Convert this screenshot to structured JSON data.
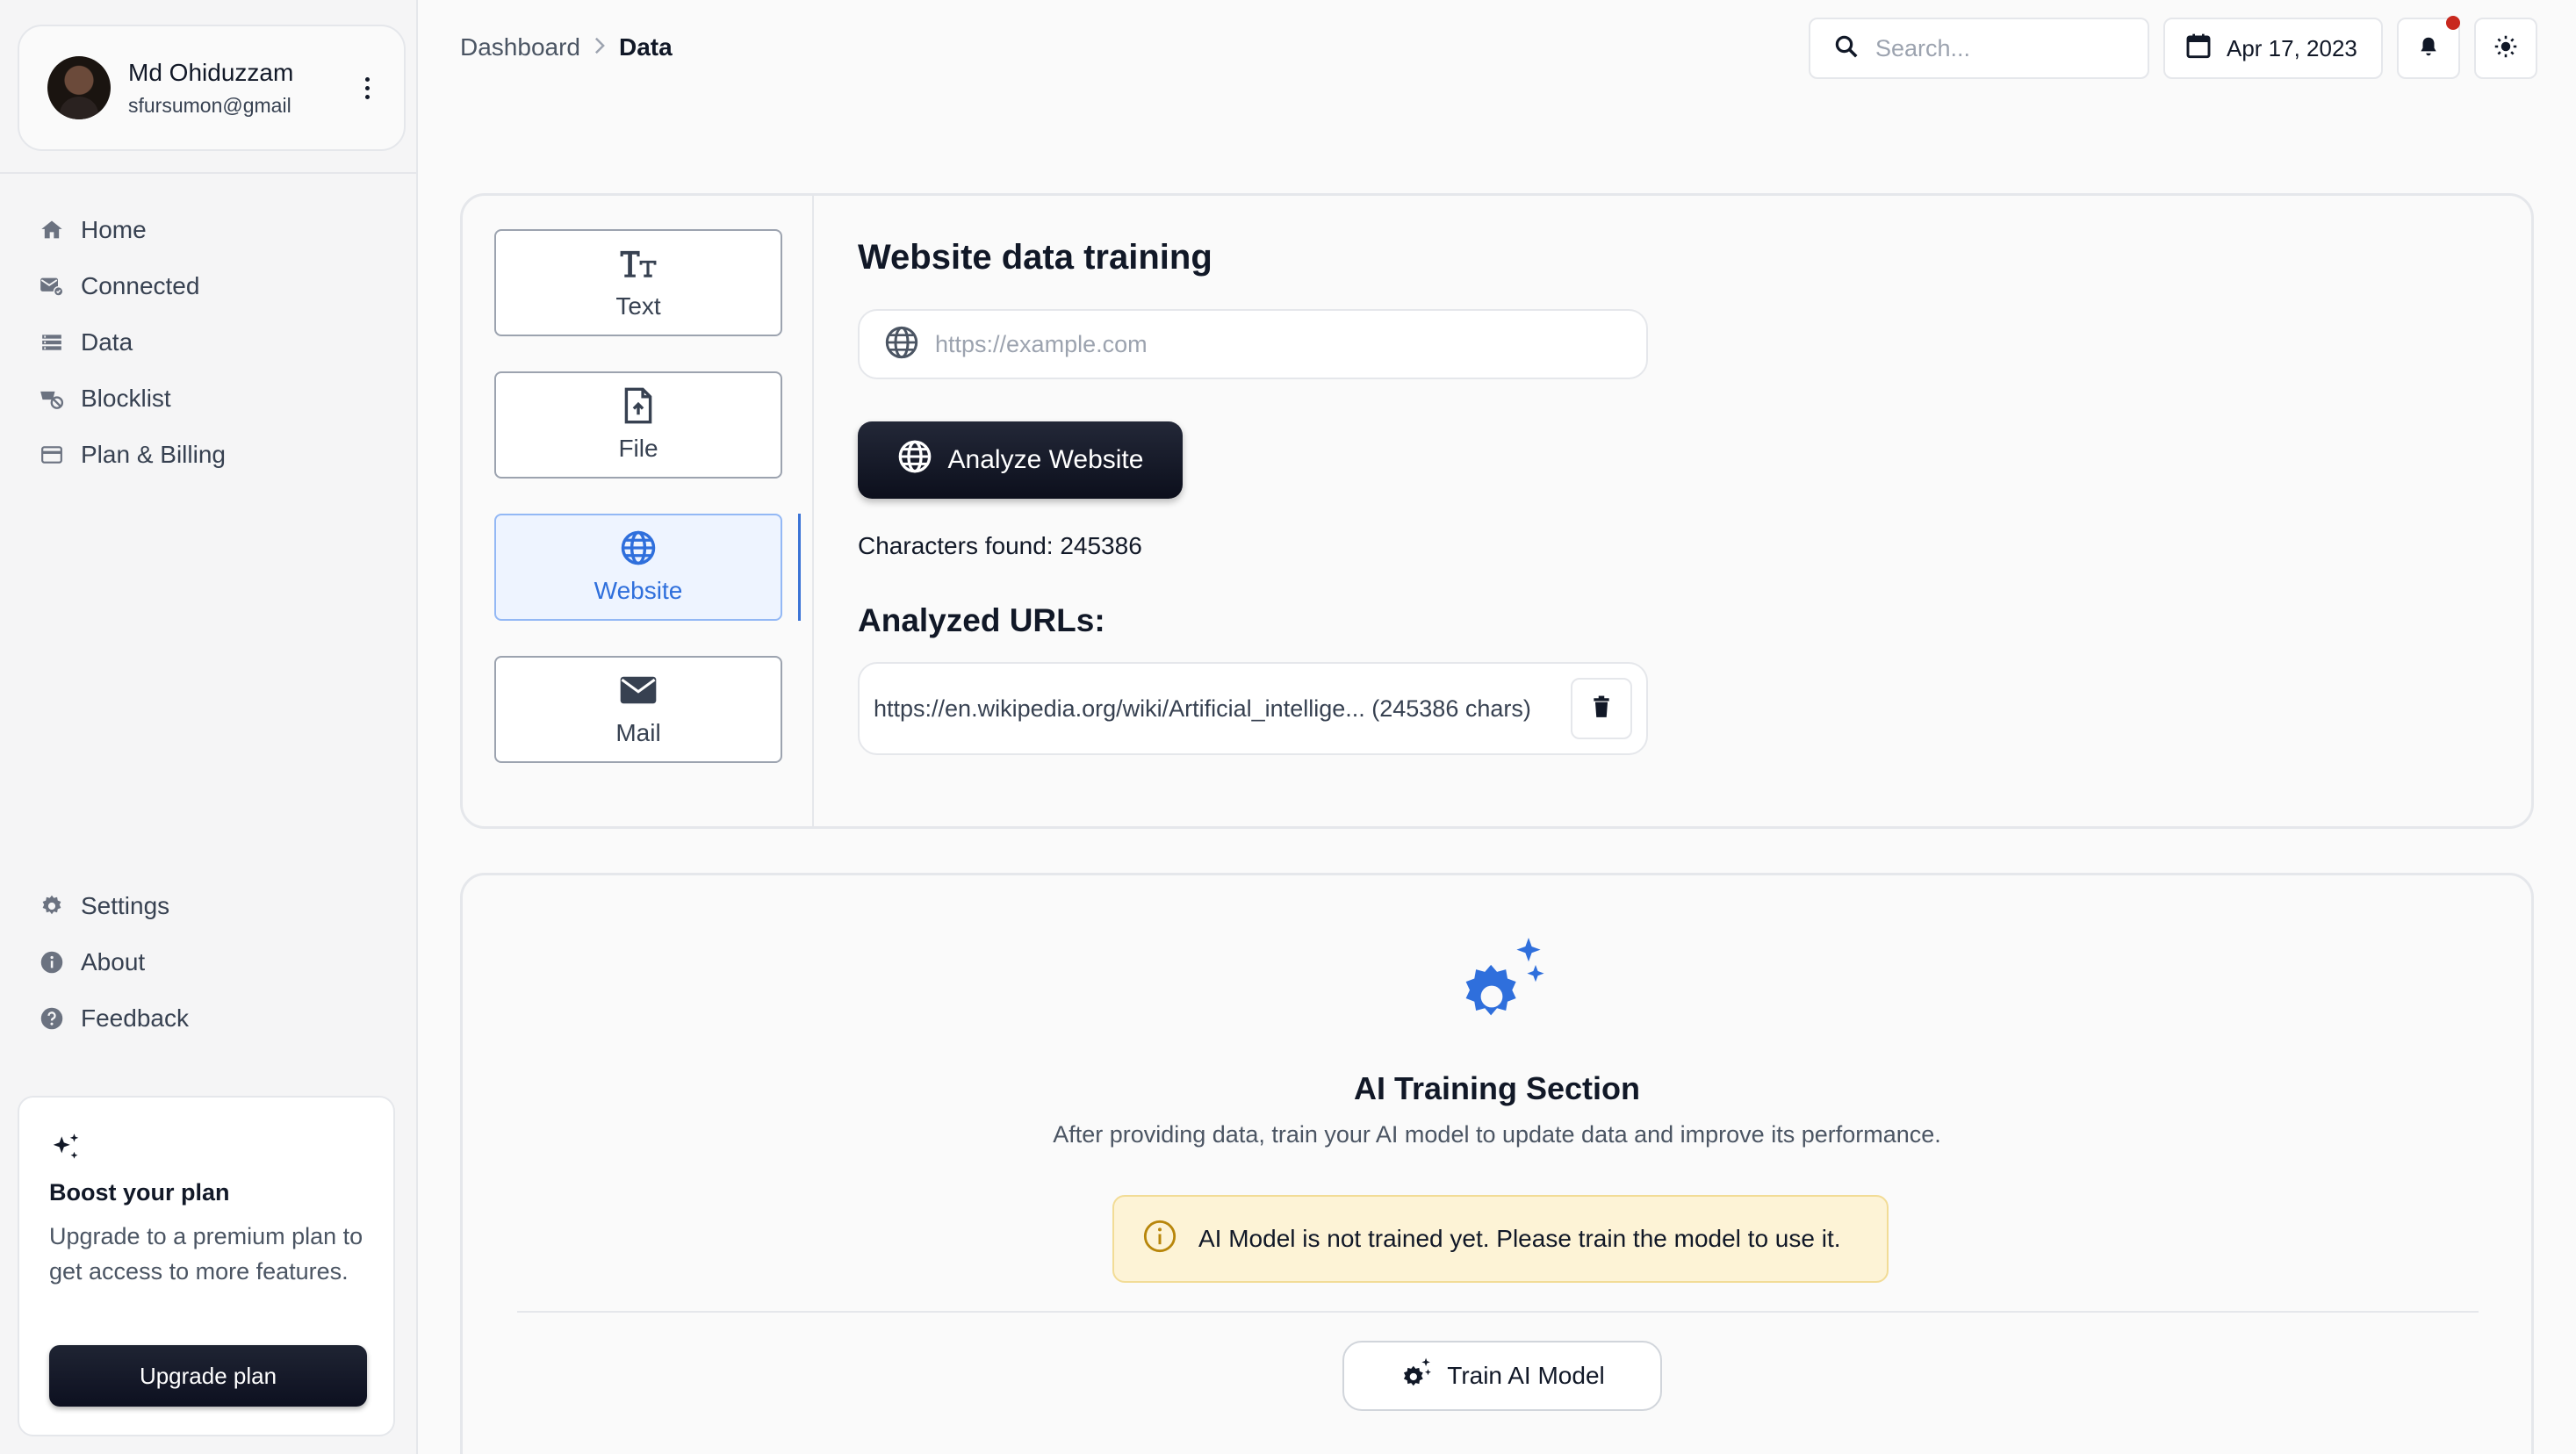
{
  "profile": {
    "name": "Md Ohiduzzam",
    "email": "sfursumon@gmail"
  },
  "sidebar": {
    "top_items": [
      {
        "label": "Home",
        "icon": "home-icon"
      },
      {
        "label": "Connected",
        "icon": "connected-icon"
      },
      {
        "label": "Data",
        "icon": "data-icon"
      },
      {
        "label": "Blocklist",
        "icon": "blocklist-icon"
      },
      {
        "label": "Plan & Billing",
        "icon": "billing-icon"
      }
    ],
    "bottom_items": [
      {
        "label": "Settings",
        "icon": "gear-icon"
      },
      {
        "label": "About",
        "icon": "info-icon"
      },
      {
        "label": "Feedback",
        "icon": "help-icon"
      }
    ],
    "boost": {
      "title": "Boost your plan",
      "description": "Upgrade to a premium plan to get access to more features.",
      "button_label": "Upgrade plan"
    }
  },
  "breadcrumb": {
    "parent": "Dashboard",
    "current": "Data"
  },
  "topbar": {
    "search_placeholder": "Search...",
    "date": "Apr 17, 2023",
    "notification_dot_color": "#c8281e"
  },
  "training_tabs": [
    {
      "label": "Text",
      "icon": "text-size-icon",
      "active": false
    },
    {
      "label": "File",
      "icon": "file-upload-icon",
      "active": false
    },
    {
      "label": "Website",
      "icon": "globe-icon",
      "active": true
    },
    {
      "label": "Mail",
      "icon": "mail-icon",
      "active": false
    }
  ],
  "website_panel": {
    "title": "Website data training",
    "url_placeholder": "https://example.com",
    "analyze_button": "Analyze Website",
    "characters_found": "Characters found: 245386",
    "analyzed_urls_title": "Analyzed URLs:",
    "analyzed_urls": [
      {
        "text": "https://en.wikipedia.org/wiki/Artificial_intellige... (245386 chars)"
      }
    ]
  },
  "ai_training": {
    "title": "AI Training Section",
    "description": "After providing data, train your AI model to update data and improve its performance.",
    "alert": "AI Model is not trained yet. Please train the model to use it.",
    "train_button": "Train AI Model"
  },
  "colors": {
    "accent_blue": "#2f6fdc",
    "dark_button": "#0d1020",
    "alert_bg": "#fdf3d6",
    "alert_icon": "#b8860b"
  }
}
